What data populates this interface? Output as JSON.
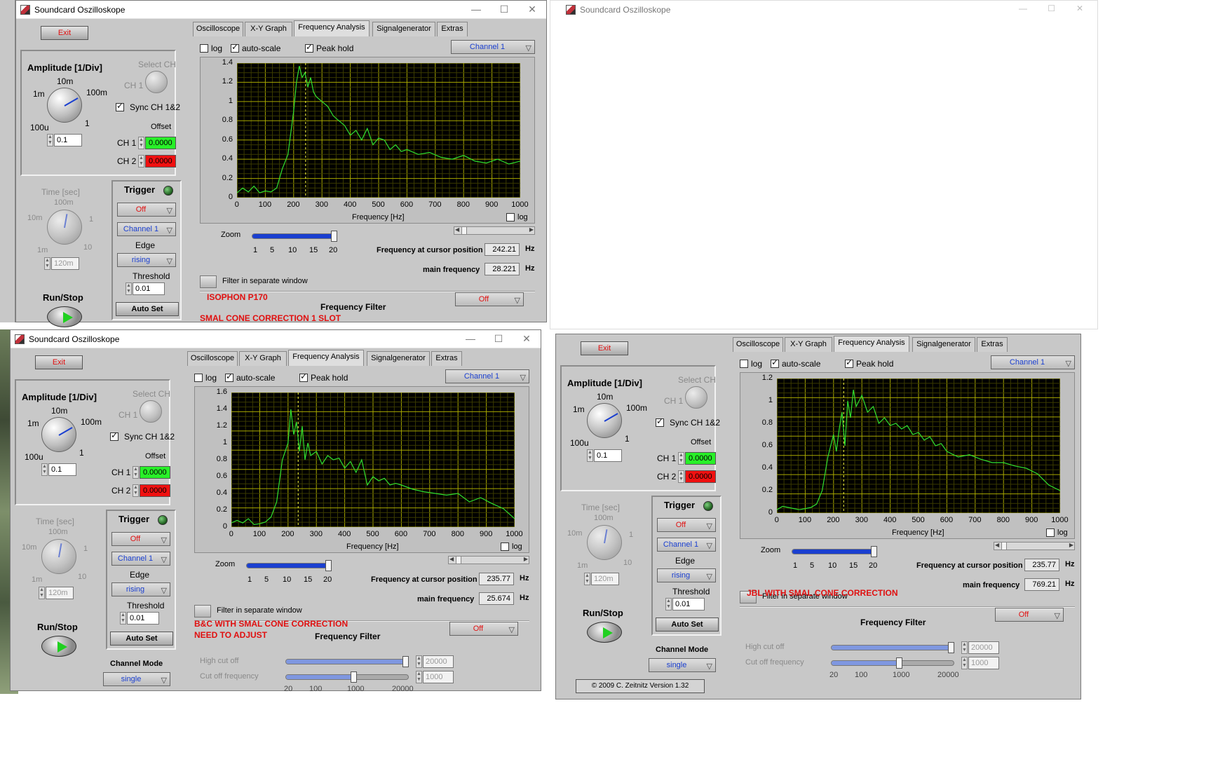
{
  "app": {
    "title": "Soundcard Oszilloskope",
    "tabs": [
      "Oscilloscope",
      "X-Y Graph",
      "Frequency Analysis",
      "Signalgenerator",
      "Extras"
    ],
    "exit_label": "Exit",
    "copyright": "© 2009  C. Zeitnitz Version 1.32"
  },
  "common": {
    "amplitude_label": "Amplitude [1/Div]",
    "amp_knob_ticks": [
      "10m",
      "1m",
      "100m",
      "100u",
      "1"
    ],
    "select_ch_label": "Select CH",
    "ch1_label": "CH 1",
    "ch2_label": "CH 2",
    "sync_label": "Sync CH 1&2",
    "offset_label": "Offset",
    "time_label": "Time [sec]",
    "time_knob_ticks": [
      "100m",
      "10m",
      "1",
      "1m",
      "10"
    ],
    "trigger_label": "Trigger",
    "trigger_mode": "Off",
    "trigger_channel": "Channel 1",
    "edge_label": "Edge",
    "edge_value": "rising",
    "threshold_label": "Threshold",
    "auto_set_label": "Auto Set",
    "run_stop_label": "Run/Stop",
    "channel_mode_label": "Channel Mode",
    "channel_mode_value": "single",
    "log_label": "log",
    "autoscale_label": "auto-scale",
    "peak_hold_label": "Peak hold",
    "channel_select": "Channel 1",
    "x_axis_label": "Frequency [Hz]",
    "x_ticks": [
      "0",
      "100",
      "200",
      "300",
      "400",
      "500",
      "600",
      "700",
      "800",
      "900",
      "1000"
    ],
    "zoom_label": "Zoom",
    "zoom_ticks": [
      "1",
      "5",
      "10",
      "15",
      "20"
    ],
    "cursor_freq_label": "Frequency at cursor position",
    "main_freq_label": "main frequency",
    "hz_unit": "Hz",
    "filter_window_label": "Filter in separate window",
    "freq_filter_label": "Frequency Filter",
    "filter_mode": "Off",
    "high_cut_label": "High cut off",
    "cut_freq_label": "Cut off frequency",
    "filter_ticks": [
      "20",
      "100",
      "1000",
      "20000"
    ],
    "truncated_values": [
      "1",
      "10"
    ]
  },
  "windows": [
    {
      "id": "top-left",
      "amplitude_value": "0.1",
      "time_value": "120m",
      "threshold": "0.01",
      "offset_ch1": "0.0000",
      "offset_ch2": "0.0000",
      "cursor_freq": "242.21",
      "main_freq": "28.221",
      "notes": [
        "ISOPHON P170",
        "SMAL CONE CORRECTION 1 SLOT"
      ],
      "chart_data": {
        "type": "line",
        "xlabel": "Frequency [Hz]",
        "xlim": [
          0,
          1000
        ],
        "ylim": [
          0,
          1.4
        ],
        "y_ticks": [
          "1.4",
          "1.2",
          "1",
          "0.8",
          "0.6",
          "0.4",
          "0.2",
          "0"
        ],
        "cursor_x": 242.21,
        "x": [
          0,
          20,
          40,
          60,
          80,
          100,
          120,
          140,
          160,
          180,
          200,
          210,
          220,
          230,
          240,
          250,
          260,
          270,
          280,
          300,
          320,
          340,
          360,
          380,
          400,
          420,
          440,
          460,
          480,
          500,
          520,
          540,
          560,
          580,
          600,
          640,
          680,
          720,
          760,
          800,
          840,
          880,
          920,
          960,
          1000
        ],
        "values": [
          0.05,
          0.1,
          0.06,
          0.12,
          0.05,
          0.07,
          0.06,
          0.1,
          0.3,
          0.45,
          0.9,
          1.2,
          1.37,
          1.25,
          1.3,
          1.15,
          1.25,
          1.1,
          1.05,
          1.0,
          0.95,
          0.85,
          0.8,
          0.75,
          0.65,
          0.7,
          0.6,
          0.72,
          0.55,
          0.62,
          0.6,
          0.5,
          0.55,
          0.48,
          0.5,
          0.45,
          0.47,
          0.42,
          0.4,
          0.44,
          0.38,
          0.36,
          0.4,
          0.35,
          0.38
        ]
      }
    },
    {
      "id": "bottom-left",
      "amplitude_value": "0.1",
      "time_value": "120m",
      "threshold": "0.01",
      "offset_ch1": "0.0000",
      "offset_ch2": "0.0000",
      "cursor_freq": "235.77",
      "main_freq": "25.674",
      "notes": [
        "B&C WITH SMAL CONE CORRECTION",
        "NEED TO ADJUST"
      ],
      "filter_high_value": "20000",
      "filter_cut_value": "1000",
      "chart_data": {
        "type": "line",
        "xlabel": "Frequency [Hz]",
        "xlim": [
          0,
          1000
        ],
        "ylim": [
          0,
          1.6
        ],
        "y_ticks": [
          "1.6",
          "1.4",
          "1.2",
          "1",
          "0.8",
          "0.6",
          "0.4",
          "0.2",
          "0"
        ],
        "cursor_x": 235.77,
        "x": [
          0,
          20,
          40,
          60,
          80,
          100,
          120,
          140,
          160,
          180,
          200,
          210,
          220,
          230,
          240,
          250,
          260,
          270,
          280,
          300,
          320,
          340,
          360,
          380,
          400,
          420,
          440,
          460,
          480,
          500,
          520,
          540,
          560,
          580,
          600,
          640,
          680,
          720,
          760,
          800,
          840,
          880,
          920,
          960,
          1000
        ],
        "values": [
          0.05,
          0.08,
          0.05,
          0.1,
          0.03,
          0.04,
          0.06,
          0.12,
          0.3,
          0.8,
          1.0,
          1.4,
          1.1,
          1.25,
          0.9,
          1.2,
          0.8,
          1.0,
          0.85,
          0.9,
          0.75,
          0.85,
          0.8,
          0.82,
          0.7,
          0.78,
          0.65,
          0.8,
          0.5,
          0.6,
          0.55,
          0.58,
          0.5,
          0.52,
          0.5,
          0.45,
          0.42,
          0.4,
          0.38,
          0.4,
          0.3,
          0.35,
          0.28,
          0.22,
          0.1
        ]
      }
    },
    {
      "id": "bottom-right",
      "amplitude_value": "0.1",
      "time_value": "120m",
      "threshold": "0.01",
      "offset_ch1": "0.0000",
      "offset_ch2": "0.0000",
      "cursor_freq": "235.77",
      "main_freq": "769.21",
      "notes": [
        "JBL WITH SMAL CONE CORRECTION"
      ],
      "filter_high_value": "20000",
      "filter_cut_value": "1000",
      "chart_data": {
        "type": "line",
        "xlabel": "Frequency [Hz]",
        "xlim": [
          0,
          1000
        ],
        "ylim": [
          0,
          1.2
        ],
        "y_ticks": [
          "1.2",
          "1",
          "0.8",
          "0.6",
          "0.4",
          "0.2",
          "0"
        ],
        "cursor_x": 235.77,
        "x": [
          0,
          20,
          40,
          60,
          80,
          100,
          120,
          140,
          160,
          180,
          200,
          210,
          220,
          230,
          240,
          250,
          260,
          270,
          280,
          300,
          320,
          340,
          360,
          380,
          400,
          420,
          440,
          460,
          480,
          500,
          520,
          540,
          560,
          580,
          600,
          640,
          680,
          720,
          760,
          800,
          840,
          880,
          920,
          960,
          1000
        ],
        "values": [
          0.03,
          0.06,
          0.05,
          0.04,
          0.03,
          0.04,
          0.05,
          0.08,
          0.2,
          0.5,
          0.7,
          0.55,
          0.75,
          0.9,
          0.6,
          1.0,
          0.85,
          1.1,
          0.95,
          1.05,
          0.9,
          0.95,
          0.8,
          0.85,
          0.78,
          0.8,
          0.75,
          0.78,
          0.7,
          0.72,
          0.65,
          0.68,
          0.6,
          0.62,
          0.55,
          0.5,
          0.52,
          0.48,
          0.45,
          0.45,
          0.42,
          0.4,
          0.35,
          0.25,
          0.2
        ]
      }
    }
  ]
}
